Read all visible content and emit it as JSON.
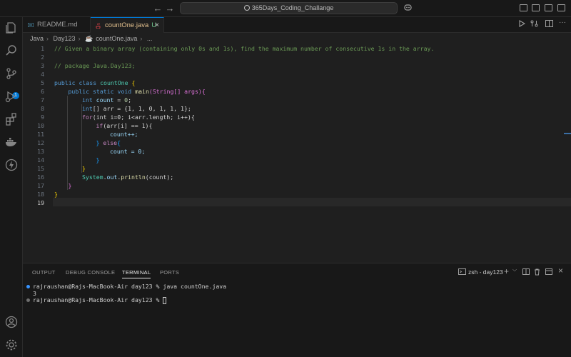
{
  "titlebar": {
    "back_arrow": "←",
    "forward_arrow": "→",
    "search_text": "365Days_Coding_Challange",
    "copilot": "⌵"
  },
  "activity": {
    "scm_badge": "1"
  },
  "tabs": [
    {
      "label": "README.md",
      "icon": "info-icon"
    },
    {
      "label": "countOne.java",
      "modified": "U",
      "icon": "java-icon",
      "close": "×"
    }
  ],
  "breadcrumb": [
    "Java",
    "Day123",
    "countOne.java",
    "..."
  ],
  "editor": {
    "line_numbers": [
      "1",
      "2",
      "3",
      "4",
      "5",
      "6",
      "7",
      "8",
      "9",
      "10",
      "11",
      "12",
      "13",
      "14",
      "15",
      "16",
      "17",
      "18",
      "19"
    ],
    "current_line": "19"
  },
  "code": {
    "l1": "// Given a binary array (containing only 0s and 1s), find the maximum number of consecutive 1s in the array.",
    "l3": "// package Java.Day123;",
    "l5_kw": "public class ",
    "l5_cls": "countOne",
    "l5_br": " {",
    "l6_kw": "public static void ",
    "l6_fn": "main",
    "l6_rest": "(String[] args){",
    "l7_kw": "int ",
    "l7_var": "count",
    "l7_op": " = ",
    "l7_num": "0",
    "l7_end": ";",
    "l8_kw": "int",
    "l8_rest": "[] arr = {1, 1, 0, 1, 1, 1};",
    "l9_kw": "for",
    "l9_rest": "(int i=0; i<arr.length; i++){",
    "l10_kw": "if",
    "l10_rest": "(arr[i] == 1){",
    "l11": "count++;",
    "l12_br": "} ",
    "l12_kw": "else",
    "l12_rest": "{",
    "l13": "count = 0;",
    "l14": "}",
    "l15": "}",
    "l16_obj": "System",
    "l16_dot": ".",
    "l16_out": "out",
    "l16_fn": "println",
    "l16_rest": "(count);",
    "l17": "}",
    "l18": "}"
  },
  "panel": {
    "tabs": [
      "OUTPUT",
      "DEBUG CONSOLE",
      "TERMINAL",
      "PORTS"
    ],
    "active_tab": "TERMINAL",
    "terminal_name": "zsh - day123",
    "plus": "+",
    "chevron": "⌵",
    "close": "×",
    "lines": [
      "rajraushan@Rajs-MacBook-Air day123 % java countOne.java",
      "3",
      "rajraushan@Rajs-MacBook-Air day123 % "
    ]
  },
  "colors": {
    "accent": "#0078d4",
    "dot_blue": "#3794ff",
    "dot_gray": "#6e6e6e"
  }
}
